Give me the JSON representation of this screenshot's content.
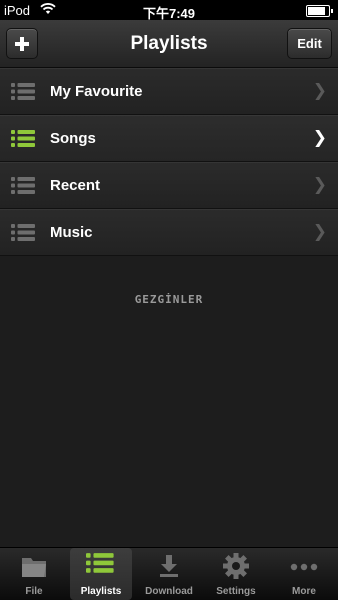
{
  "status_bar": {
    "carrier": "iPod",
    "time": "下午7:49",
    "battery_level": 0.92
  },
  "nav": {
    "title": "Playlists",
    "add_label": "+",
    "edit_label": "Edit"
  },
  "playlists": [
    {
      "label": "My Favourite",
      "active": false
    },
    {
      "label": "Songs",
      "active": true
    },
    {
      "label": "Recent",
      "active": false
    },
    {
      "label": "Music",
      "active": false
    }
  ],
  "watermark": "GEZGİNLER",
  "tabs": [
    {
      "label": "File",
      "icon": "folder-icon",
      "active": false
    },
    {
      "label": "Playlists",
      "icon": "list-icon",
      "active": true
    },
    {
      "label": "Download",
      "icon": "download-icon",
      "active": false
    },
    {
      "label": "Settings",
      "icon": "gear-icon",
      "active": false
    },
    {
      "label": "More",
      "icon": "more-icon",
      "active": false
    }
  ],
  "colors": {
    "accent": "#8fc83a",
    "inactive_icon": "#6e6e6e",
    "chevron": "#5a5a5a"
  }
}
